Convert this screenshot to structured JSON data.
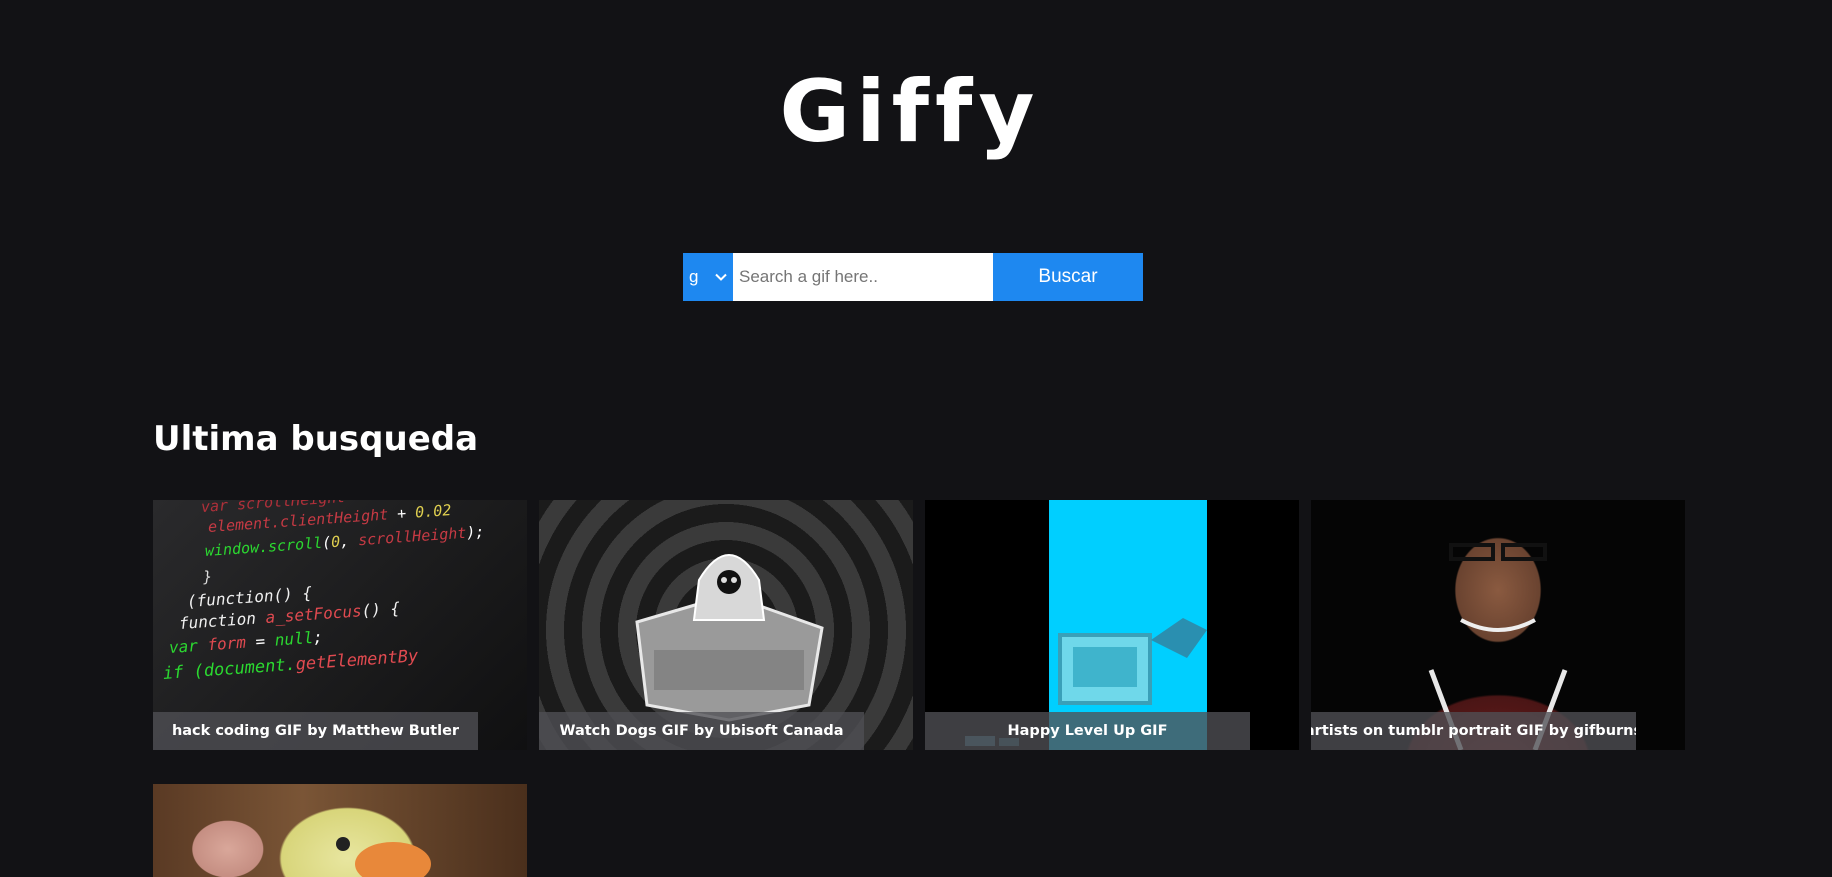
{
  "app": {
    "logo": "Giffy"
  },
  "search": {
    "rating_value": "g",
    "placeholder": "Search a gif here..",
    "button_label": "Buscar"
  },
  "results": {
    "section_title": "Ultima busqueda",
    "items": [
      {
        "title": "hack coding GIF by Matthew Butler"
      },
      {
        "title": "Watch Dogs GIF by Ubisoft Canada"
      },
      {
        "title": "Happy Level Up GIF"
      },
      {
        "title": "artists on tumblr portrait GIF by gifburns"
      },
      {
        "title": ""
      }
    ]
  },
  "colors": {
    "background": "#121215",
    "accent": "#1e88f0",
    "caption_bg": "#505054"
  }
}
